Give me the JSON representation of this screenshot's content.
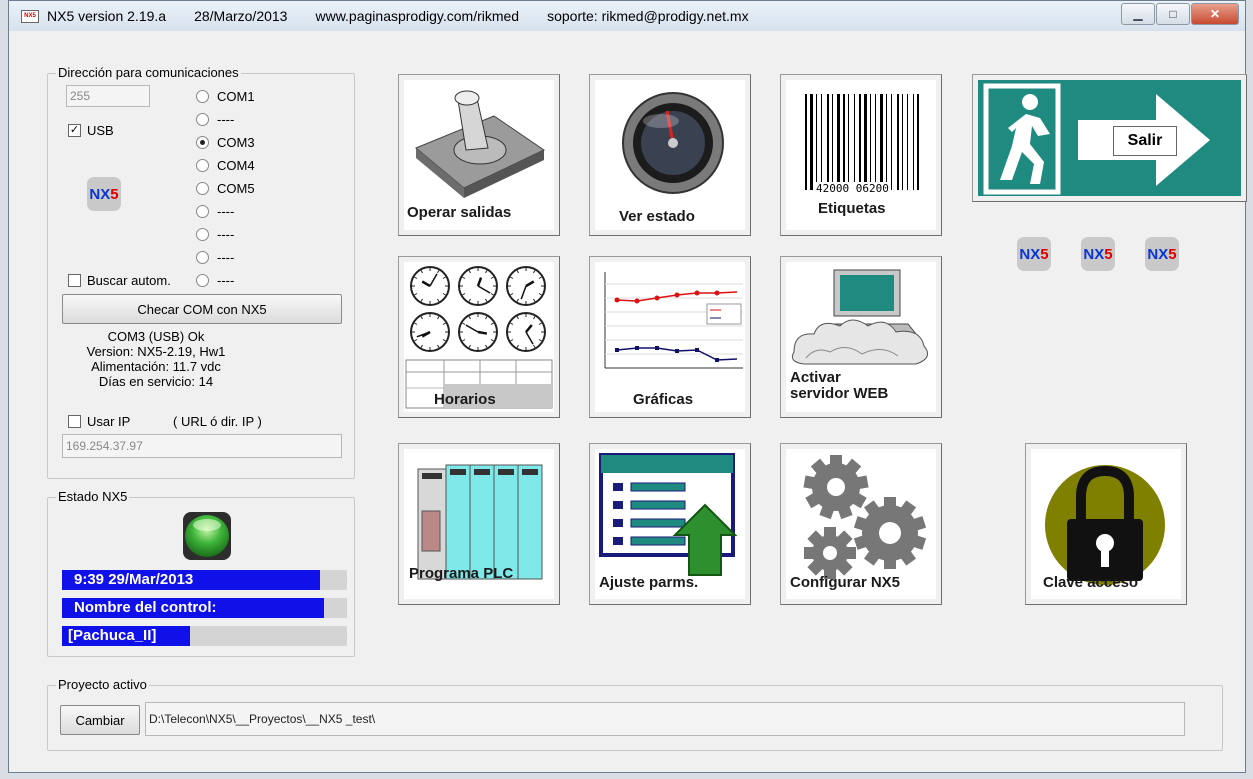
{
  "titlebar": {
    "version": "NX5 version 2.19.a",
    "date": "28/Marzo/2013",
    "url": "www.paginasprodigy.com/rikmed",
    "support": "soporte: rikmed@prodigy.net.mx"
  },
  "comms": {
    "legend": "Dirección para comunicaciones",
    "address": "255",
    "usb_label": "USB",
    "ports": [
      "COM1",
      "----",
      "COM3",
      "COM4",
      "COM5",
      "----",
      "----",
      "----",
      "----"
    ],
    "selected_port": "COM3",
    "buscar_label": "Buscar autom.",
    "checar_button": "Checar COM con NX5",
    "status_lines": [
      "COM3 (USB) Ok",
      "Version: NX5-2.19, Hw1",
      "Alimentación: 11.7 vdc",
      "Días en servicio: 14"
    ],
    "usar_ip_label": "Usar IP",
    "ip_hint": "( URL ó dir. IP )",
    "ip_value": "169.254.37.97"
  },
  "logo": {
    "prefix": "NX",
    "suffix": "5"
  },
  "estado": {
    "legend": "Estado NX5",
    "datetime": "9:39   29/Mar/2013",
    "name_label": "Nombre del control:",
    "name_value": "[Pachuca_II]"
  },
  "tiles": {
    "operar": "Operar salidas",
    "ver": "Ver estado",
    "etiquetas": "Etiquetas",
    "barcode_number": "42000 06200",
    "salir": "Salir",
    "horarios": "Horarios",
    "graficas": "Gráficas",
    "activar_1": "Activar",
    "activar_2": "servidor WEB",
    "programa": "Programa PLC",
    "ajuste": "Ajuste parms.",
    "configurar": "Configurar NX5",
    "clave": "Clave acceso"
  },
  "proyecto": {
    "legend": "Proyecto activo",
    "cambiar_button": "Cambiar",
    "path": "D:\\Telecon\\NX5\\__Proyectos\\__NX5 _test\\"
  },
  "colors": {
    "accent_blue": "#1010e8",
    "salir_green": "#1f8a80",
    "led_green": "#3db53a"
  }
}
